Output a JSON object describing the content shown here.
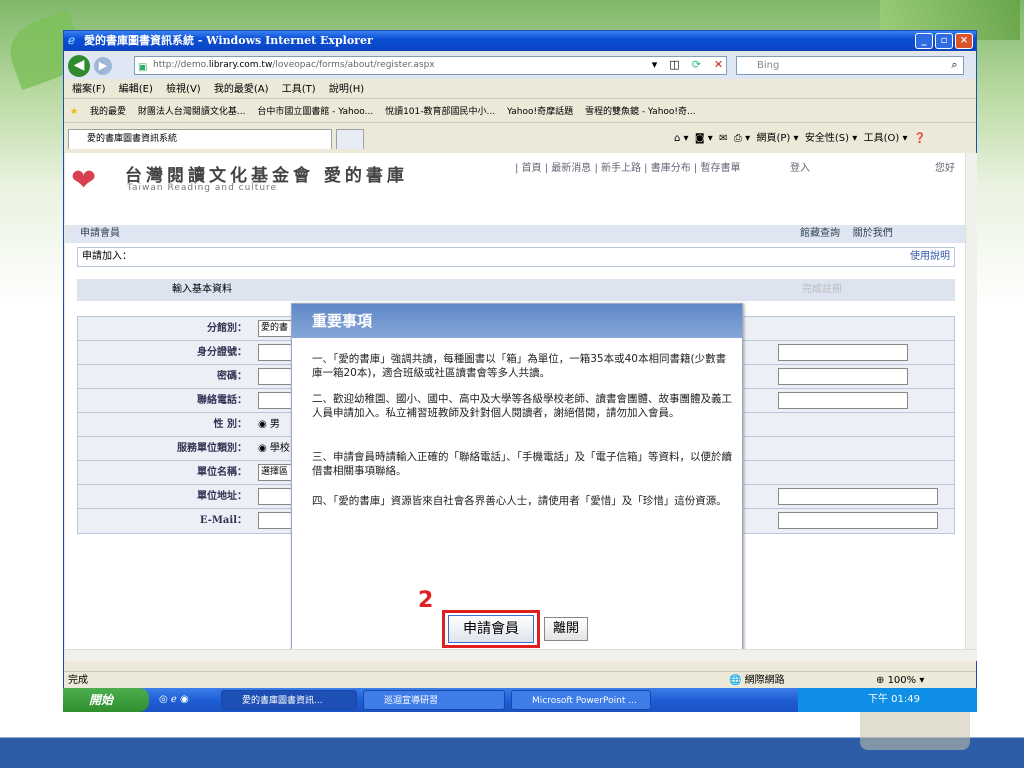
{
  "window": {
    "title": "愛的書庫圖書資訊系統 - Windows Internet Explorer",
    "min_label": "_",
    "max_label": "▫",
    "close_label": "×"
  },
  "nav": {
    "address": "http://demo.",
    "address_bold": "library.com.tw",
    "address_rest": "/loveopac/forms/about/register.aspx",
    "search_placeholder": "Bing"
  },
  "menu": [
    "檔案(F)",
    "編輯(E)",
    "檢視(V)",
    "我的最愛(A)",
    "工具(T)",
    "說明(H)"
  ],
  "favorites": [
    "我的最愛",
    "財團法人台灣閱讀文化基...",
    "台中市國立圖書館 - Yahoo...",
    "悅讀101-教育部國民中小...",
    "Yahoo!奇摩話題",
    "雪程的雙魚鏡 - Yahoo!奇..."
  ],
  "tab": {
    "label": "愛的書庫圖書資訊系統"
  },
  "command_bar": {
    "page": "網頁(P) ▾",
    "safety": "安全性(S) ▾",
    "tools": "工具(O) ▾"
  },
  "site": {
    "org_name": "台灣閱讀文化基金會 愛的書庫",
    "org_en": "Taiwan Reading and culture",
    "top_links": "| 首頁 | 最新消息 | 新手上路 | 書庫分布 | 暫存書單",
    "login": "登入",
    "hello": "您好",
    "member_bar": "申請會員",
    "nav_right": [
      "館藏查詢",
      "關於我們"
    ],
    "join_label": "申請加入：",
    "help_link": "使用說明",
    "step1": "輸入基本資料",
    "step3": "完成註冊"
  },
  "form": {
    "rows": [
      {
        "label": "分館別：",
        "value": "愛的書"
      },
      {
        "label": "身分證號：",
        "value": ""
      },
      {
        "label": "密碼：",
        "value": ""
      },
      {
        "label": "聯絡電話：",
        "value": ""
      },
      {
        "label": "性 別：",
        "radio": "男"
      },
      {
        "label": "服務單位類別：",
        "radio": "學校"
      },
      {
        "label": "單位名稱：",
        "value": "選擇區"
      },
      {
        "label": "單位地址：",
        "value": ""
      },
      {
        "label": "E-Mail：",
        "value": ""
      }
    ]
  },
  "modal": {
    "title": "重要事項",
    "p1": "一、「愛的書庫」強調共讀，每種圖書以「箱」為單位，一箱35本或40本相同書籍(少數書庫一箱20本)，適合班級或社區讀書會等多人共讀。",
    "p2": "二、歡迎幼稚園、國小、國中、高中及大學等各級學校老師、讀書會團體、故事團體及義工人員申請加入。私立補習班教師及針對個人閱讀者，謝絕借閱，請勿加入會員。",
    "p3": "三、申請會員時請輸入正確的「聯絡電話」、「手機電話」及「電子信箱」等資料，以便於續借書相關事項聯絡。",
    "p4": "四、「愛的書庫」資源皆來自社會各界善心人士，請使用者「愛惜」及「珍惜」這份資源。",
    "apply_button": "申請會員",
    "leave_button": "離開",
    "step_number": "2"
  },
  "status": {
    "left": "完成",
    "zone": "網際網路",
    "zoom": "100%"
  },
  "taskbar": {
    "start": "開始",
    "tasks": [
      "愛的書庫圖書資訊...",
      "巡迴宣導研習",
      "Microsoft PowerPoint ..."
    ],
    "clock": "下午 01:49"
  },
  "colors": {
    "accent": "#0a4fd4",
    "highlight": "#e02020",
    "modal_header": "#6f93cf"
  }
}
